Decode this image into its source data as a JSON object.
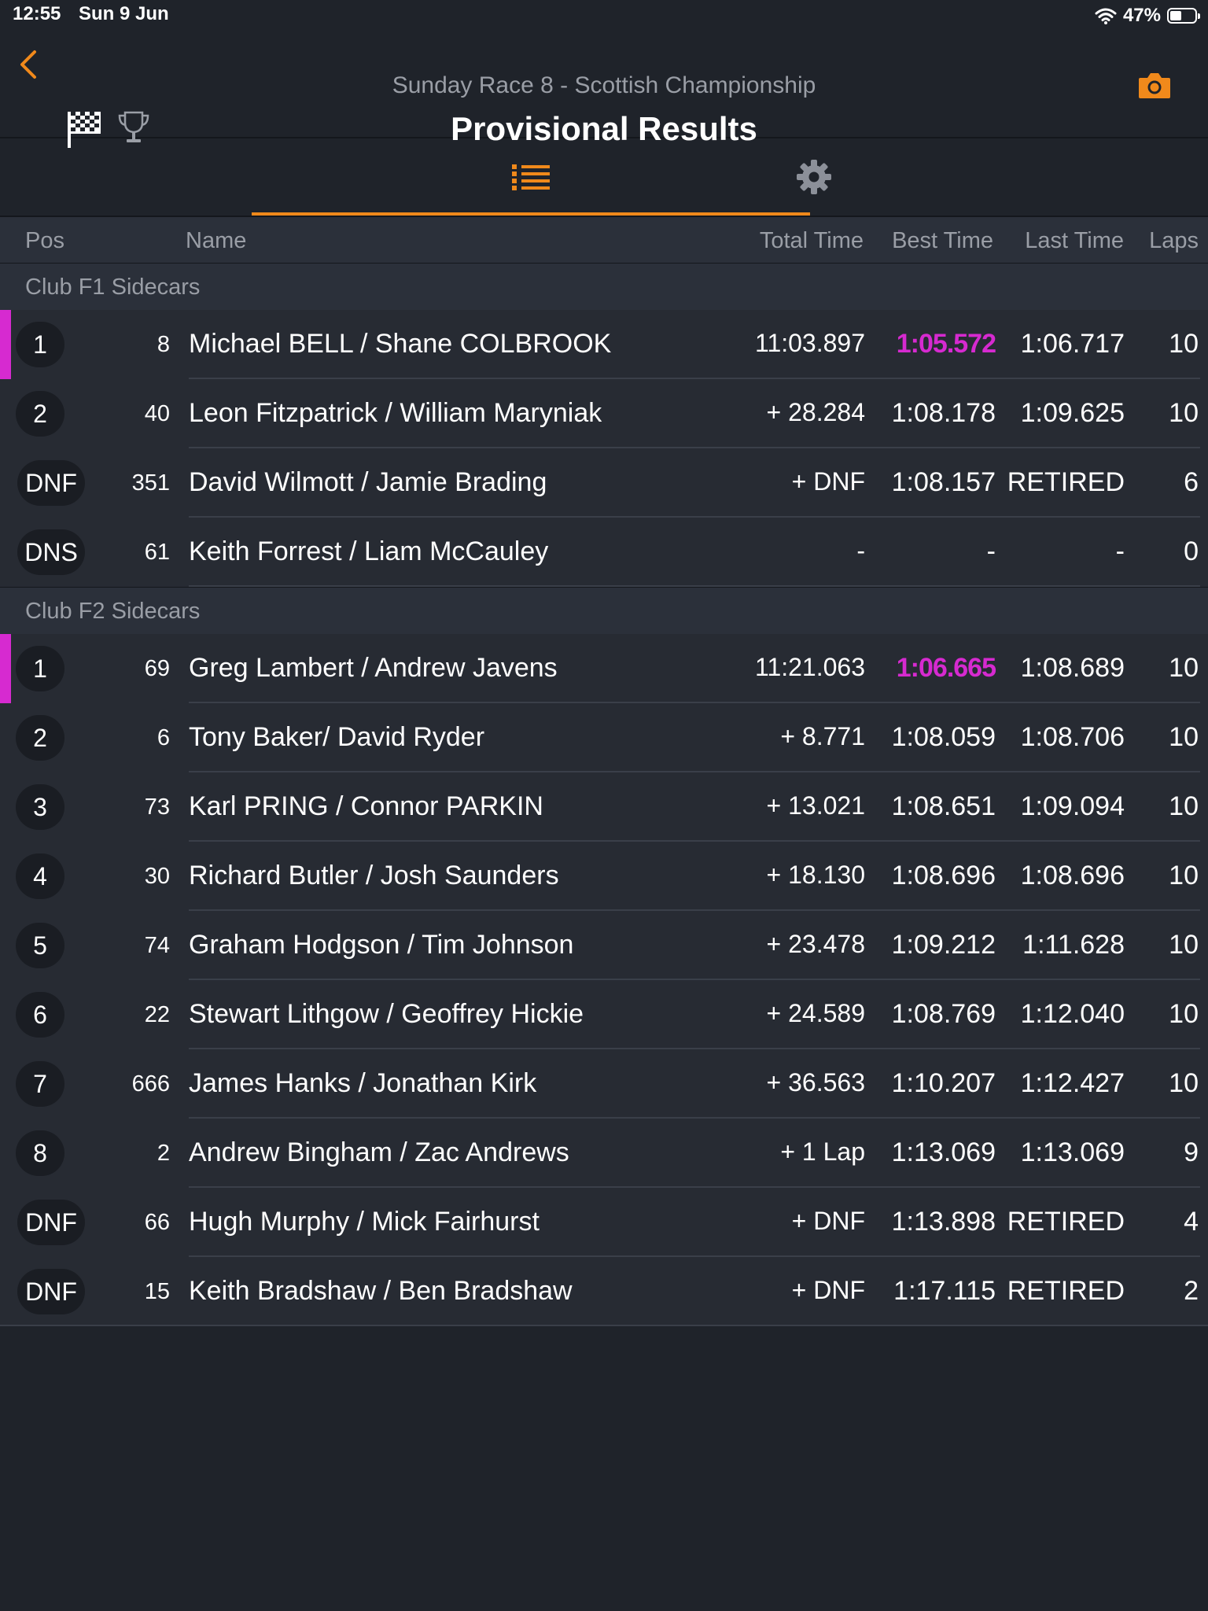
{
  "status_bar": {
    "time": "12:55",
    "date": "Sun 9 Jun",
    "battery": "47%",
    "battery_level": 0.47
  },
  "header": {
    "subtitle": "Sunday Race 8 - Scottish Championship",
    "title": "Provisional Results",
    "icons": [
      "back-chevron-icon",
      "checkered-flag-icon",
      "trophy-icon",
      "camera-icon"
    ]
  },
  "tabs": [
    {
      "icon": "list-icon",
      "selected": true
    },
    {
      "icon": "gear-icon",
      "selected": false
    }
  ],
  "colors": {
    "accent": "#f0891b",
    "best_time_highlight": "#d62ad0",
    "background": "#1f232a"
  },
  "columns": {
    "pos": "Pos",
    "name": "Name",
    "total": "Total Time",
    "best": "Best Time",
    "last": "Last Time",
    "laps": "Laps"
  },
  "groups": [
    {
      "name": "Club F1 Sidecars",
      "rows": [
        {
          "pos": "1",
          "num": "8",
          "name": "Michael BELL / Shane COLBROOK",
          "total": "11:03.897",
          "best": "1:05.572",
          "last": "1:06.717",
          "laps": "10",
          "highlight": true
        },
        {
          "pos": "2",
          "num": "40",
          "name": "Leon Fitzpatrick / William Maryniak",
          "total": "+ 28.284",
          "best": "1:08.178",
          "last": "1:09.625",
          "laps": "10",
          "highlight": false
        },
        {
          "pos": "DNF",
          "num": "351",
          "name": "David Wilmott /  Jamie Brading",
          "total": "+ DNF",
          "best": "1:08.157",
          "last": "RETIRED",
          "laps": "6",
          "highlight": false
        },
        {
          "pos": "DNS",
          "num": "61",
          "name": "Keith Forrest / Liam McCauley",
          "total": "-",
          "best": "-",
          "last": "-",
          "laps": "0",
          "highlight": false
        }
      ]
    },
    {
      "name": "Club F2 Sidecars",
      "rows": [
        {
          "pos": "1",
          "num": "69",
          "name": "Greg Lambert / Andrew Javens",
          "total": "11:21.063",
          "best": "1:06.665",
          "last": "1:08.689",
          "laps": "10",
          "highlight": true
        },
        {
          "pos": "2",
          "num": "6",
          "name": "Tony Baker/ David Ryder",
          "total": "+ 8.771",
          "best": "1:08.059",
          "last": "1:08.706",
          "laps": "10",
          "highlight": false
        },
        {
          "pos": "3",
          "num": "73",
          "name": "Karl PRING / Connor PARKIN",
          "total": "+ 13.021",
          "best": "1:08.651",
          "last": "1:09.094",
          "laps": "10",
          "highlight": false
        },
        {
          "pos": "4",
          "num": "30",
          "name": "Richard Butler /  Josh Saunders",
          "total": "+ 18.130",
          "best": "1:08.696",
          "last": "1:08.696",
          "laps": "10",
          "highlight": false
        },
        {
          "pos": "5",
          "num": "74",
          "name": "Graham Hodgson / Tim Johnson",
          "total": "+ 23.478",
          "best": "1:09.212",
          "last": "1:11.628",
          "laps": "10",
          "highlight": false
        },
        {
          "pos": "6",
          "num": "22",
          "name": "Stewart Lithgow / Geoffrey Hickie",
          "total": "+ 24.589",
          "best": "1:08.769",
          "last": "1:12.040",
          "laps": "10",
          "highlight": false
        },
        {
          "pos": "7",
          "num": "666",
          "name": "James Hanks /  Jonathan Kirk",
          "total": "+ 36.563",
          "best": "1:10.207",
          "last": "1:12.427",
          "laps": "10",
          "highlight": false
        },
        {
          "pos": "8",
          "num": "2",
          "name": "Andrew Bingham / Zac Andrews",
          "total": "+ 1 Lap",
          "best": "1:13.069",
          "last": "1:13.069",
          "laps": "9",
          "highlight": false
        },
        {
          "pos": "DNF",
          "num": "66",
          "name": "Hugh Murphy / Mick Fairhurst",
          "total": "+ DNF",
          "best": "1:13.898",
          "last": "RETIRED",
          "laps": "4",
          "highlight": false
        },
        {
          "pos": "DNF",
          "num": "15",
          "name": "Keith Bradshaw / Ben Bradshaw",
          "total": "+ DNF",
          "best": "1:17.115",
          "last": "RETIRED",
          "laps": "2",
          "highlight": false
        }
      ]
    }
  ]
}
